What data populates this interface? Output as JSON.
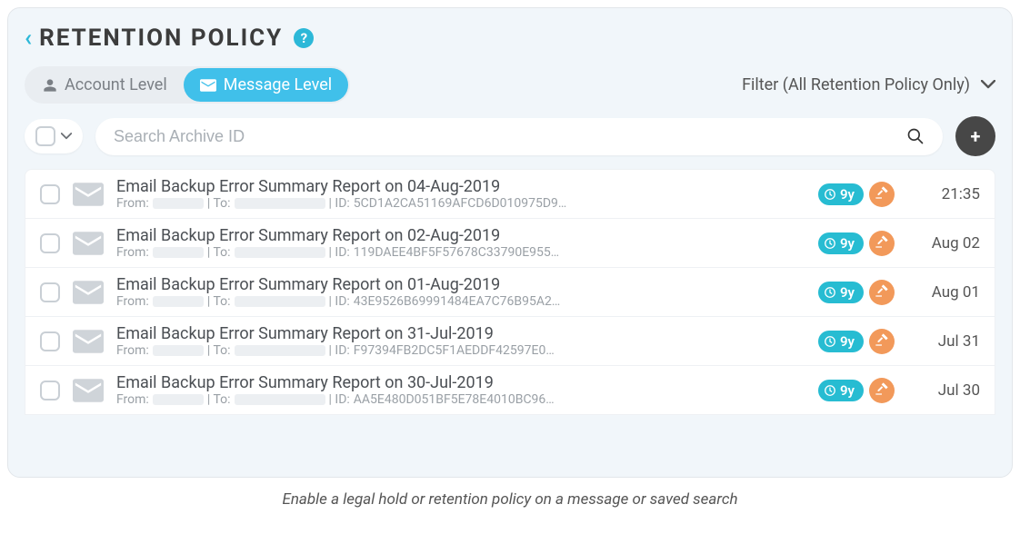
{
  "header": {
    "title": "Retention Policy"
  },
  "tabs": {
    "account": "Account Level",
    "message": "Message Level"
  },
  "filter_label": "Filter (All Retention Policy Only)",
  "search": {
    "placeholder": "Search Archive ID"
  },
  "retention_badge": "9y",
  "meta_labels": {
    "from": "From:",
    "to": "| To:",
    "id": "| ID:"
  },
  "rows": [
    {
      "title": "Email Backup Error Summary Report on 04-Aug-2019",
      "id": "5CD1A2CA51169AFCD6D010975D9…",
      "date": "21:35"
    },
    {
      "title": "Email Backup Error Summary Report on 02-Aug-2019",
      "id": "119DAEE4BF5F57678C33790E955…",
      "date": "Aug 02"
    },
    {
      "title": "Email Backup Error Summary Report on 01-Aug-2019",
      "id": "43E9526B69991484EA7C76B95A2…",
      "date": "Aug 01"
    },
    {
      "title": "Email Backup Error Summary Report on 31-Jul-2019",
      "id": "F97394FB2DC5F1AEDDF42597E0…",
      "date": "Jul 31"
    },
    {
      "title": "Email Backup Error Summary Report on 30-Jul-2019",
      "id": "AA5E480D051BF5E78E4010BC96…",
      "date": "Jul 30"
    }
  ],
  "caption": "Enable a legal hold or retention policy on a message or saved search"
}
